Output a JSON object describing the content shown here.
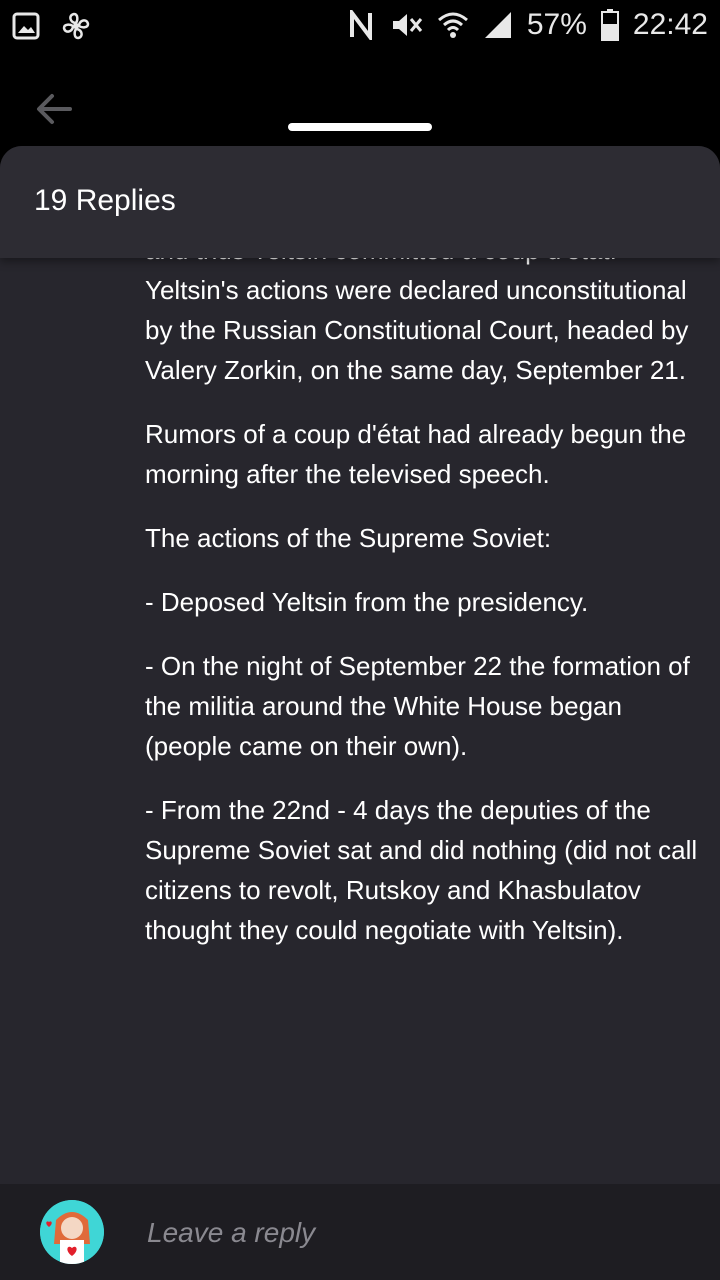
{
  "status_bar": {
    "battery": "57%",
    "time": "22:42"
  },
  "sheet": {
    "title": "19 Replies"
  },
  "reply": {
    "paragraphs": [
      "and thus Yeltsin committed a coup d'etat. Yeltsin's actions were declared unconstitutional by the Russian Constitutional Court, headed by Valery Zorkin, on the same day, September 21.",
      "Rumors of a coup d'état had already begun the morning after the televised speech.",
      "The actions of the Supreme Soviet:",
      "- Deposed Yeltsin from the presidency.",
      "- On the night of September 22 the formation of the militia around the White House began (people came on their own).",
      "- From the 22nd - 4 days the deputies of the Supreme Soviet sat and did nothing (did not call citizens to revolt, Rutskoy and Khasbulatov thought they could negotiate with Yeltsin)."
    ]
  },
  "composer": {
    "placeholder": "Leave a reply"
  },
  "colors": {
    "sheet_bg": "#27262d",
    "header_bg": "#2d2c33",
    "composer_bg": "#1e1d22",
    "text": "#ffffff",
    "placeholder": "#8a8990"
  },
  "icons": {
    "status_left": [
      "gallery-icon",
      "pinwheel-icon"
    ],
    "status_right": [
      "nfc-icon",
      "mute-icon",
      "wifi-icon",
      "signal-icon",
      "battery-icon"
    ],
    "nav": [
      "back-arrow-icon"
    ]
  }
}
